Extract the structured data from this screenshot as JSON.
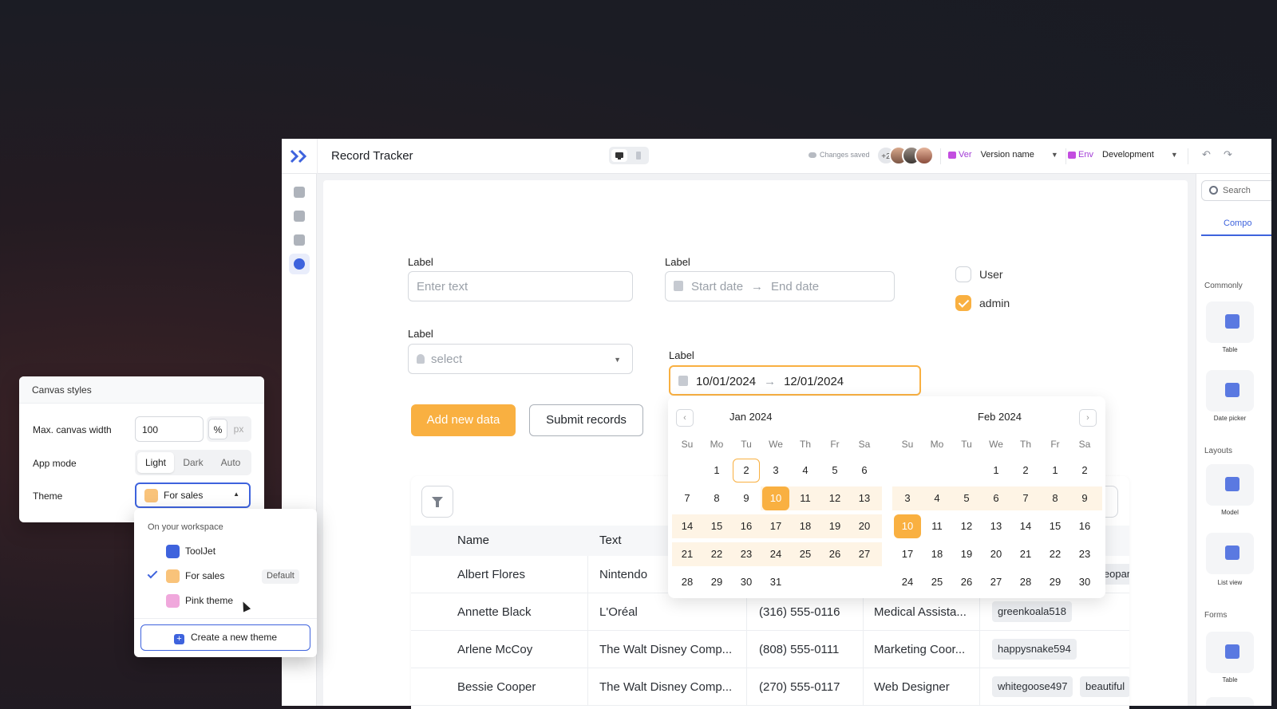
{
  "app": {
    "title": "Record Tracker",
    "saved_status": "Changes saved",
    "collab_extra": "+2",
    "version_tag": "Ver",
    "version_name": "Version name",
    "env_tag": "Env",
    "env_name": "Development",
    "accent": "#3e63dd",
    "brand_orange": "#f9b041"
  },
  "right_panel": {
    "search_placeholder": "Search",
    "tab_label": "Compo",
    "sections": [
      "Commonly",
      "Layouts",
      "Forms"
    ],
    "tiles": [
      "Table",
      "Date picker",
      "Model",
      "List view",
      "Table"
    ]
  },
  "form": {
    "text_label": "Label",
    "text_placeholder": "Enter text",
    "date_label": "Label",
    "date_start_placeholder": "Start date",
    "date_end_placeholder": "End date",
    "select_label": "Label",
    "select_placeholder": "select",
    "range_label": "Label",
    "range_start": "10/01/2024",
    "range_end": "12/01/2024",
    "checkbox_user": "User",
    "checkbox_admin": "admin",
    "btn_add": "Add new data",
    "btn_submit": "Submit records"
  },
  "table": {
    "columns": [
      "Name",
      "Text"
    ],
    "rows": [
      {
        "name": "Albert Flores",
        "company": "Nintendo",
        "phone": "",
        "role": "",
        "tags": [
          "leopar"
        ]
      },
      {
        "name": "Annette Black",
        "company": "L'Oréal",
        "phone": "(316) 555-0116",
        "role": "Medical Assista...",
        "tags": [
          "greenkoala518"
        ]
      },
      {
        "name": "Arlene McCoy",
        "company": "The Walt Disney Comp...",
        "phone": "(808) 555-0111",
        "role": "Marketing Coor...",
        "tags": [
          "happysnake594"
        ]
      },
      {
        "name": "Bessie Cooper",
        "company": "The Walt Disney Comp...",
        "phone": "(270) 555-0117",
        "role": "Web Designer",
        "tags": [
          "whitegoose497",
          "beautiful"
        ]
      }
    ]
  },
  "calendar": {
    "left_title": "Jan 2024",
    "right_title": "Feb 2024",
    "weekdays": [
      "Su",
      "Mo",
      "Tu",
      "We",
      "Th",
      "Fr",
      "Sa"
    ],
    "prev": "‹",
    "next": "›",
    "jan_weeks": [
      [
        "",
        "1",
        "2",
        "3",
        "4",
        "5",
        "6"
      ],
      [
        "7",
        "8",
        "9",
        "10",
        "11",
        "12",
        "13"
      ],
      [
        "14",
        "15",
        "16",
        "17",
        "18",
        "19",
        "20"
      ],
      [
        "21",
        "22",
        "23",
        "24",
        "25",
        "26",
        "27"
      ],
      [
        "28",
        "29",
        "30",
        "31",
        "",
        "",
        ""
      ]
    ],
    "feb_weeks": [
      [
        "",
        "",
        "",
        "1",
        "2",
        "1",
        "2"
      ],
      [
        "3",
        "4",
        "5",
        "6",
        "7",
        "8",
        "9"
      ],
      [
        "10",
        "11",
        "12",
        "13",
        "14",
        "15",
        "16"
      ],
      [
        "17",
        "18",
        "19",
        "20",
        "21",
        "22",
        "23"
      ],
      [
        "24",
        "25",
        "26",
        "27",
        "28",
        "29",
        "30"
      ]
    ]
  },
  "canvas_styles": {
    "title": "Canvas styles",
    "max_width_label": "Max. canvas width",
    "max_width_value": "100",
    "unit_percent": "%",
    "unit_px": "px",
    "app_mode_label": "App mode",
    "modes": [
      "Light",
      "Dark",
      "Auto"
    ],
    "theme_label": "Theme",
    "theme_value": "For sales"
  },
  "theme_menu": {
    "section": "On your workspace",
    "items": [
      {
        "name": "ToolJet",
        "color": "#3e63dd"
      },
      {
        "name": "For sales",
        "color": "#f9c37a",
        "badge": "Default"
      },
      {
        "name": "Pink theme",
        "color": "#f0a8dc"
      }
    ],
    "create_label": "Create a new theme"
  }
}
